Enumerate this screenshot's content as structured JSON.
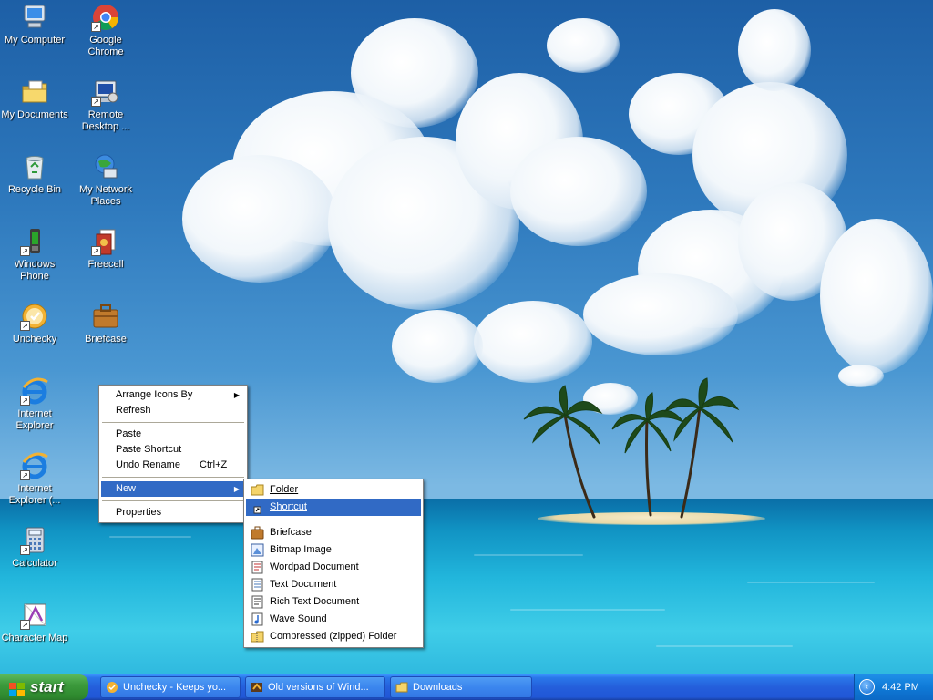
{
  "desktop_icons": [
    {
      "label": "My Computer",
      "icon": "my-computer-icon"
    },
    {
      "label": "Google Chrome",
      "icon": "chrome-icon"
    },
    {
      "label": "My Documents",
      "icon": "my-documents-icon"
    },
    {
      "label": "Remote Desktop ...",
      "icon": "remote-desktop-icon"
    },
    {
      "label": "Recycle Bin",
      "icon": "recycle-bin-icon"
    },
    {
      "label": "My Network Places",
      "icon": "network-places-icon"
    },
    {
      "label": "Windows Phone",
      "icon": "windows-phone-icon"
    },
    {
      "label": "Freecell",
      "icon": "freecell-icon"
    },
    {
      "label": "Unchecky",
      "icon": "unchecky-icon"
    },
    {
      "label": "Briefcase",
      "icon": "briefcase-icon"
    },
    {
      "label": "Internet Explorer",
      "icon": "internet-explorer-icon"
    },
    {
      "label": "Internet Explorer (...",
      "icon": "internet-explorer-icon"
    },
    {
      "label": "Calculator",
      "icon": "calculator-icon"
    },
    {
      "label": "Character Map",
      "icon": "character-map-icon"
    }
  ],
  "context_menu": {
    "arrange_icons_by": "Arrange Icons By",
    "refresh": "Refresh",
    "paste": "Paste",
    "paste_shortcut": "Paste Shortcut",
    "undo_rename": "Undo Rename",
    "undo_rename_accel": "Ctrl+Z",
    "new": "New",
    "properties": "Properties",
    "submenu_arrow": "▶"
  },
  "new_submenu": {
    "folder": "Folder",
    "shortcut": "Shortcut",
    "items": [
      {
        "label": "Briefcase",
        "icon": "briefcase-icon"
      },
      {
        "label": "Bitmap Image",
        "icon": "bitmap-icon"
      },
      {
        "label": "Wordpad Document",
        "icon": "wordpad-icon"
      },
      {
        "label": "Text Document",
        "icon": "text-document-icon"
      },
      {
        "label": "Rich Text Document",
        "icon": "rich-text-icon"
      },
      {
        "label": "Wave Sound",
        "icon": "wave-sound-icon"
      },
      {
        "label": "Compressed (zipped) Folder",
        "icon": "zip-folder-icon"
      }
    ]
  },
  "taskbar": {
    "start_label": "start",
    "tasks": [
      {
        "label": "Unchecky - Keeps yo...",
        "icon": "unchecky-icon"
      },
      {
        "label": "Old versions of Wind...",
        "icon": "browser-icon"
      },
      {
        "label": "Downloads",
        "icon": "folder-icon"
      }
    ],
    "tray_expand": "‹",
    "clock": "4:42 PM"
  },
  "colors": {
    "menu_highlight": "#316ac5",
    "taskbar_blue": "#245edb",
    "start_green": "#3c9a3c"
  }
}
